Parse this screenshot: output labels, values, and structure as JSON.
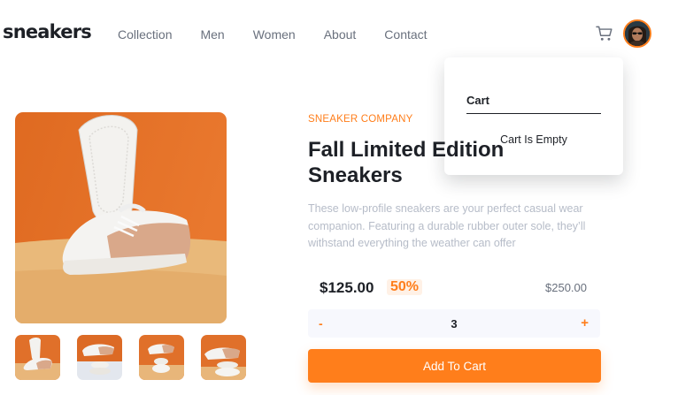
{
  "header": {
    "logo": "sneakers",
    "nav": [
      "Collection",
      "Men",
      "Women",
      "About",
      "Contact"
    ]
  },
  "cart": {
    "title": "Cart",
    "empty_message": "Cart Is Empty"
  },
  "product": {
    "company": "SNEAKER COMPANY",
    "title": "Fall Limited Edition Sneakers",
    "description": "These low-profile sneakers are your perfect casual wear companion. Featuring a durable rubber outer sole, they’ll withstand everything the weather can offer",
    "price": "$125.00",
    "discount": "50%",
    "original_price": "$250.00",
    "quantity": "3",
    "minus_label": "-",
    "plus_label": "+",
    "add_to_cart_label": "Add To Cart"
  },
  "colors": {
    "accent": "#ff7e1b",
    "accent_light": "#fff1e6",
    "text_dark": "#1d2026",
    "text_grey": "#69707d",
    "text_light": "#b6bcc8",
    "qty_bg": "#f7f8fd"
  },
  "icons": {
    "cart": "cart-icon",
    "avatar": "user-avatar"
  }
}
